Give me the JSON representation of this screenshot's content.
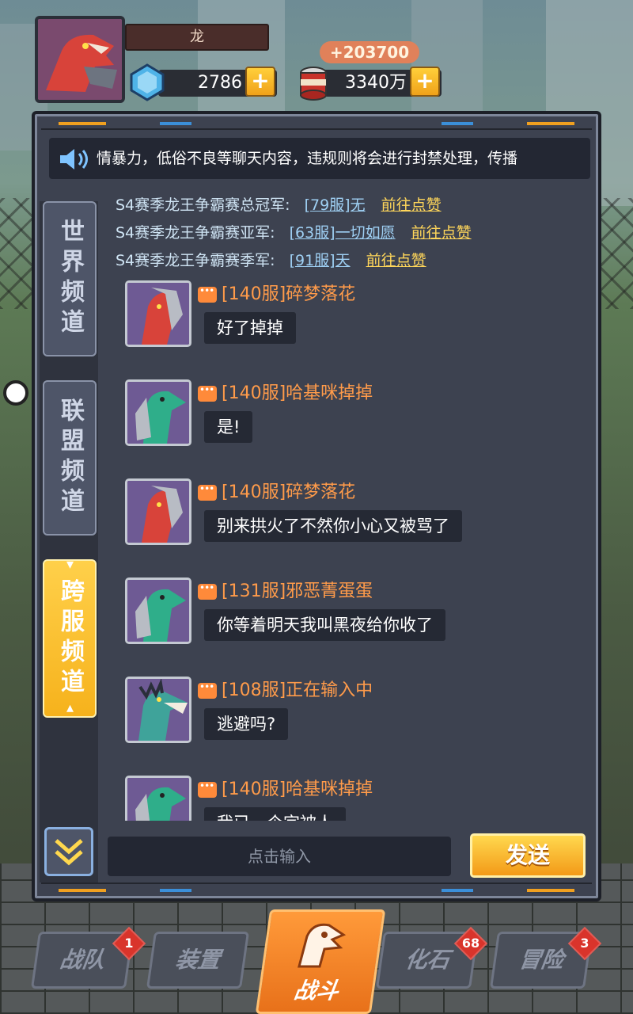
{
  "hud": {
    "player_name": "龙",
    "gems": "2786",
    "food": "3340万",
    "food_gain": "+203700",
    "plus_label": "+"
  },
  "announcement": {
    "text": "情暴力，低俗不良等聊天内容，违规则将会进行封禁处理，传播"
  },
  "tabs": [
    {
      "label": "世界频道",
      "active": false
    },
    {
      "label": "联盟频道",
      "active": false
    },
    {
      "label": "跨服频道",
      "active": true
    }
  ],
  "champions": [
    {
      "title": "S4赛季龙王争霸赛总冠军:",
      "server": "[79服]无",
      "action": "前往点赞"
    },
    {
      "title": "S4赛季龙王争霸赛亚军:",
      "server": "[63服]一切如愿",
      "action": "前往点赞"
    },
    {
      "title": "S4赛季龙王争霸赛季军:",
      "server": "[91服]天",
      "action": "前往点赞"
    }
  ],
  "messages": [
    {
      "nick": "[140服]碎梦落花",
      "text": "好了掉掉",
      "avatar": "red-armored-dino"
    },
    {
      "nick": "[140服]哈基咪掉掉",
      "text": "是!",
      "avatar": "green-armored-dino"
    },
    {
      "nick": "[140服]碎梦落花",
      "text": "别来拱火了不然你小心又被骂了",
      "avatar": "red-armored-dino"
    },
    {
      "nick": "[131服]邪恶菁蛋蛋",
      "text": "你等着明天我叫黑夜给你收了",
      "avatar": "green-armored-dino"
    },
    {
      "nick": "[108服]正在输入中",
      "text": "逃避吗?",
      "avatar": "teal-spiky-dino"
    },
    {
      "nick": "[140服]哈基咪掉掉",
      "text": "我已一个字被人",
      "avatar": "green-armored-dino"
    }
  ],
  "input": {
    "placeholder": "点击输入",
    "send_label": "发送"
  },
  "nav": [
    {
      "label": "战队",
      "badge": "1"
    },
    {
      "label": "装置",
      "badge": ""
    },
    {
      "label": "战斗",
      "badge": ""
    },
    {
      "label": "化石",
      "badge": "68"
    },
    {
      "label": "冒险",
      "badge": "3"
    }
  ],
  "colors": {
    "panel_bg": "#3d4250",
    "nick": "#ff9b4a",
    "link": "#ffd65a",
    "active_tab": "#f6b21c"
  }
}
